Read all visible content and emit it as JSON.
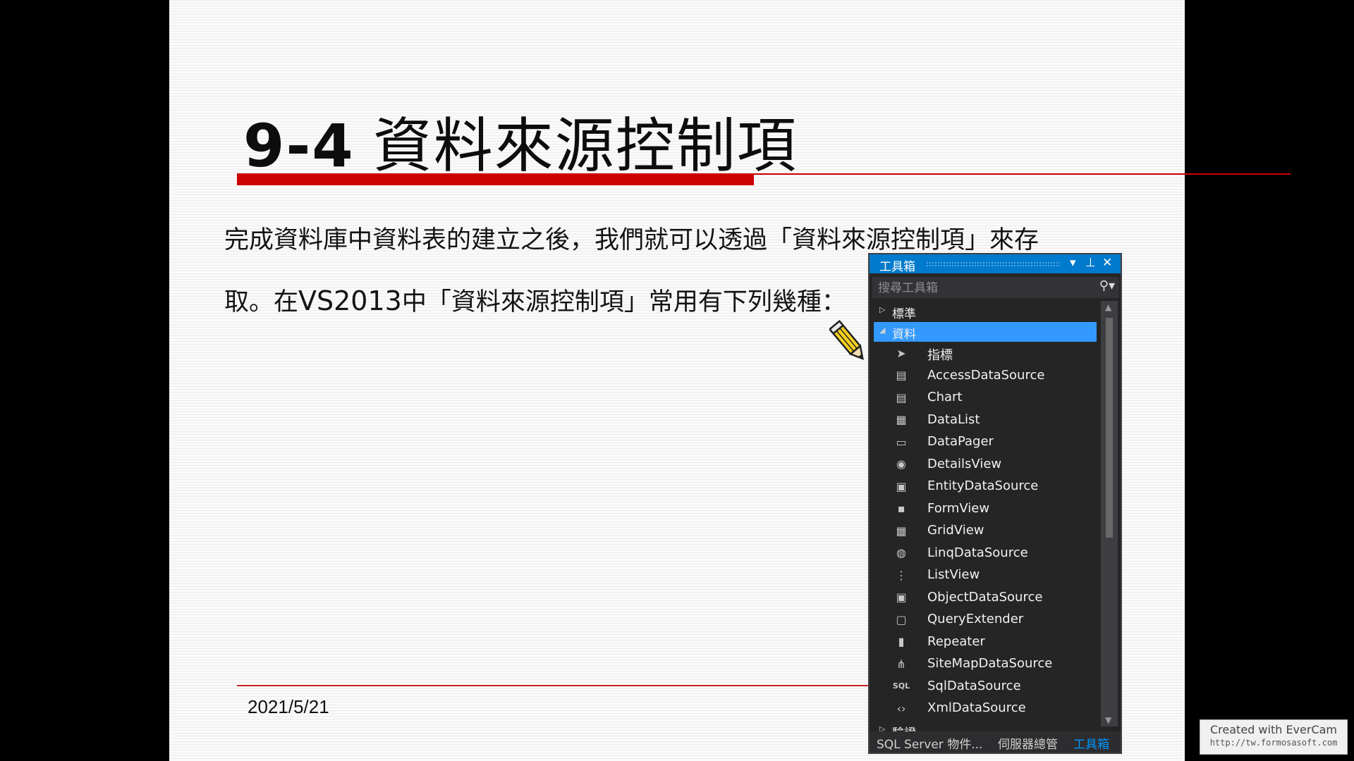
{
  "slide": {
    "title_num": "9-4",
    "title_text": "資料來源控制項",
    "body_line1": "完成資料庫中資料表的建立之後，我們就可以透過「資料來源控制項」來存",
    "body_line2_a": "取。在",
    "body_line2_b": "VS2013",
    "body_line2_c": "中「資料來源控制項」常用有下列幾種：",
    "date": "2021/5/21",
    "accent_color": "#cc0000"
  },
  "toolbox": {
    "title": "工具箱",
    "controls": [
      "▾",
      "⊥",
      "✕"
    ],
    "search_placeholder": "搜尋工具箱",
    "groups": {
      "standard": "標準",
      "data": "資料",
      "validation": "驗證"
    },
    "items": [
      {
        "label": "指標",
        "icon": "pointer-icon",
        "glyph": "➤"
      },
      {
        "label": "AccessDataSource",
        "icon": "datasource-icon",
        "glyph": "▤"
      },
      {
        "label": "Chart",
        "icon": "chart-icon",
        "glyph": "▤"
      },
      {
        "label": "DataList",
        "icon": "datalist-icon",
        "glyph": "▦"
      },
      {
        "label": "DataPager",
        "icon": "datapager-icon",
        "glyph": "▭"
      },
      {
        "label": "DetailsView",
        "icon": "detailsview-icon",
        "glyph": "◉"
      },
      {
        "label": "EntityDataSource",
        "icon": "entity-icon",
        "glyph": "▣"
      },
      {
        "label": "FormView",
        "icon": "formview-icon",
        "glyph": "▪"
      },
      {
        "label": "GridView",
        "icon": "gridview-icon",
        "glyph": "▦"
      },
      {
        "label": "LinqDataSource",
        "icon": "linq-icon",
        "glyph": "◍"
      },
      {
        "label": "ListView",
        "icon": "listview-icon",
        "glyph": "⋮"
      },
      {
        "label": "ObjectDataSource",
        "icon": "object-icon",
        "glyph": "▣"
      },
      {
        "label": "QueryExtender",
        "icon": "query-icon",
        "glyph": "▢"
      },
      {
        "label": "Repeater",
        "icon": "repeater-icon",
        "glyph": "▮"
      },
      {
        "label": "SiteMapDataSource",
        "icon": "sitemap-icon",
        "glyph": "⋔"
      },
      {
        "label": "SqlDataSource",
        "icon": "sql-icon",
        "glyph": "SQL"
      },
      {
        "label": "XmlDataSource",
        "icon": "xml-icon",
        "glyph": "‹›"
      }
    ],
    "tabs": [
      "SQL Server 物件...",
      "伺服器總管",
      "工具箱"
    ]
  },
  "watermark": {
    "line1": "Created with EverCam",
    "line2": "http://tw.formosasoft.com"
  }
}
